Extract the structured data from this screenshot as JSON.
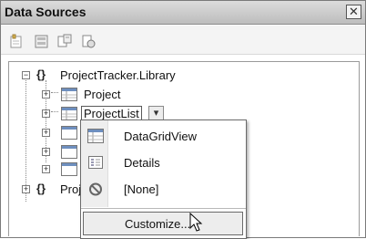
{
  "window": {
    "title": "Data Sources",
    "close_glyph": "✕"
  },
  "toolbar": {
    "buttons": [
      {
        "name": "add-new-data-source-icon"
      },
      {
        "name": "edit-dataset-icon"
      },
      {
        "name": "configure-dataset-icon"
      },
      {
        "name": "refresh-icon"
      }
    ]
  },
  "tree": {
    "namespace1": {
      "symbol": "{}",
      "label": "ProjectTracker.Library"
    },
    "item_project": {
      "label": "Project"
    },
    "item_projectlist": {
      "label": "ProjectList",
      "dropdown_glyph": "▾"
    },
    "namespace2": {
      "symbol": "{}",
      "label": "Proj"
    }
  },
  "context_menu": {
    "items": [
      {
        "label": "DataGridView",
        "icon": "datagridview-icon"
      },
      {
        "label": "Details",
        "icon": "details-icon"
      },
      {
        "label": "[None]",
        "icon": "none-icon"
      }
    ],
    "customize_label": "Customize..."
  }
}
